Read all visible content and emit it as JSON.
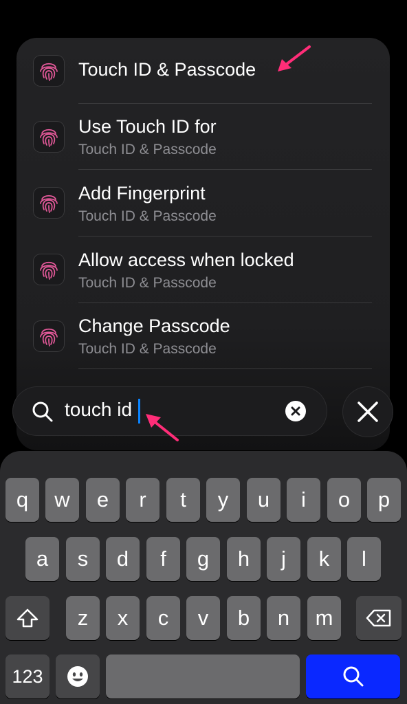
{
  "results": [
    {
      "title": "Touch ID & Passcode",
      "subtitle": ""
    },
    {
      "title": "Use Touch ID for",
      "subtitle": "Touch ID & Passcode"
    },
    {
      "title": "Add Fingerprint",
      "subtitle": "Touch ID & Passcode"
    },
    {
      "title": "Allow access when locked",
      "subtitle": "Touch ID & Passcode"
    },
    {
      "title": "Change Passcode",
      "subtitle": "Touch ID & Passcode"
    }
  ],
  "search": {
    "value": "touch id",
    "icon": "search-icon",
    "clear_icon": "clear-icon",
    "close_icon": "close-icon"
  },
  "keyboard": {
    "row1": [
      "q",
      "w",
      "e",
      "r",
      "t",
      "y",
      "u",
      "i",
      "o",
      "p"
    ],
    "row2": [
      "a",
      "s",
      "d",
      "f",
      "g",
      "h",
      "j",
      "k",
      "l"
    ],
    "row3": [
      "z",
      "x",
      "c",
      "v",
      "b",
      "n",
      "m"
    ],
    "numbers_label": "123",
    "shift_icon": "shift-icon",
    "delete_icon": "delete-icon",
    "emoji_icon": "emoji-icon",
    "search_icon": "search-icon"
  },
  "colors": {
    "accent": "#0a84ff",
    "annotation": "#ff2d78",
    "search_key": "#0a28ff"
  }
}
